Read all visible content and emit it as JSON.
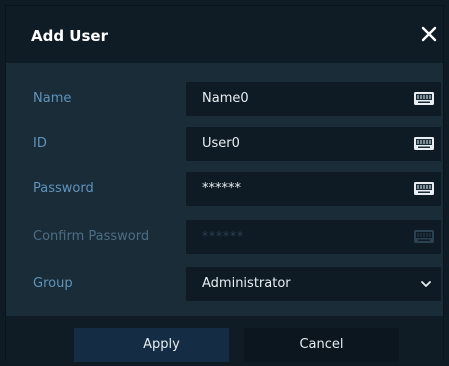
{
  "dialog": {
    "title": "Add User",
    "close_icon": "close-icon"
  },
  "form": {
    "name": {
      "label": "Name",
      "value": "Name0",
      "icon": "keyboard-icon"
    },
    "id": {
      "label": "ID",
      "value": "User0",
      "icon": "keyboard-icon"
    },
    "password": {
      "label": "Password",
      "value": "******",
      "icon": "keyboard-icon"
    },
    "confirm_password": {
      "label": "Confirm Password",
      "value": "******",
      "icon": "keyboard-icon",
      "disabled": true
    },
    "group": {
      "label": "Group",
      "value": "Administrator",
      "icon": "chevron-down-icon"
    }
  },
  "buttons": {
    "apply": "Apply",
    "cancel": "Cancel"
  },
  "colors": {
    "background": "#1a2c38",
    "title_bar": "#0f1c25",
    "label": "#5f93bc",
    "apply_button": "#142d44"
  }
}
